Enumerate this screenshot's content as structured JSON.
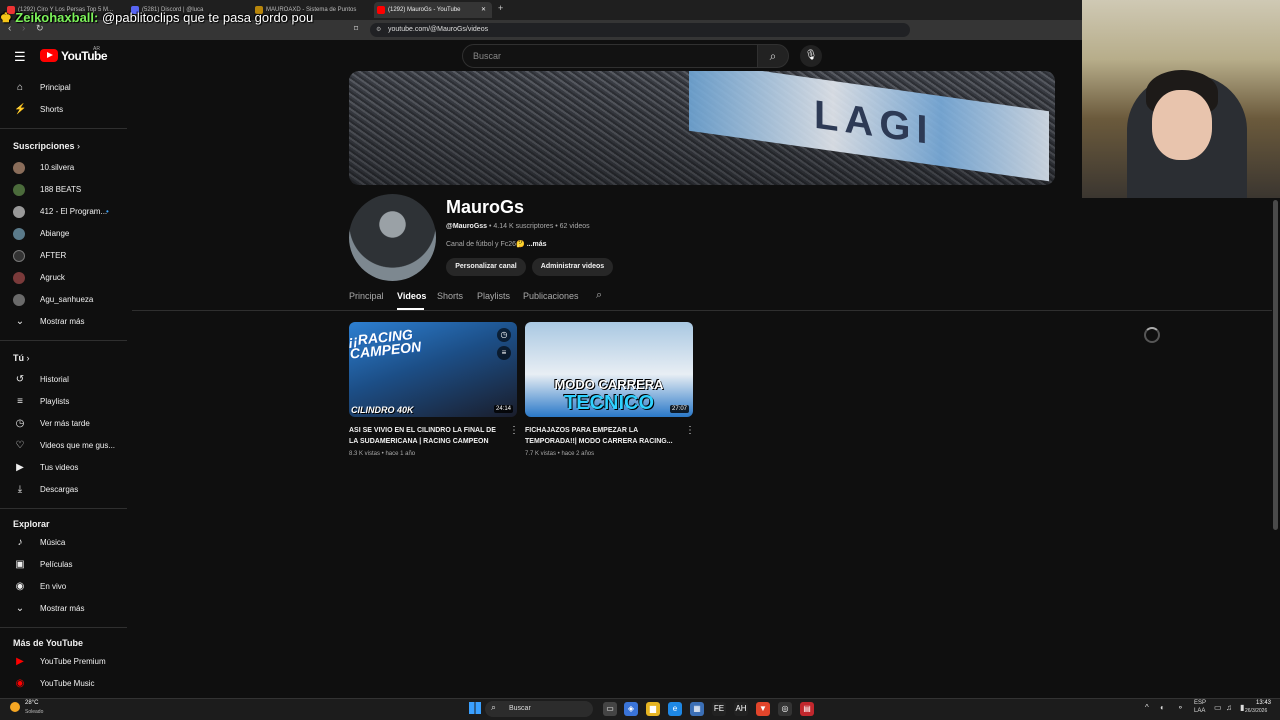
{
  "browser": {
    "tabs": [
      {
        "label": "(1292) Ciro Y Los Persas Top 5 M...",
        "color": "#e33"
      },
      {
        "label": "(5281) Discord | @luca",
        "color": "#5865f2"
      },
      {
        "label": "MAUROAXD - Sistema de Puntos",
        "color": "#b8860b"
      },
      {
        "label": "(1292) MauroGs - YouTube",
        "color": "#ff0000"
      }
    ],
    "url": "youtube.com/@MauroGs/videos"
  },
  "chat_overlay": {
    "user": "Zeikohaxball:",
    "message": " @pablitoclips que te pasa gordo pou"
  },
  "header": {
    "logo_text": "YouTube",
    "region": "AR",
    "search_placeholder": "Buscar"
  },
  "sidebar": {
    "main": [
      {
        "label": "Principal",
        "icon": "⌂"
      },
      {
        "label": "Shorts",
        "icon": "⚡"
      }
    ],
    "subs_heading": "Suscripciones",
    "subscriptions": [
      {
        "label": "10.silvera",
        "color": "#8a6d5a"
      },
      {
        "label": "188 BEATS",
        "color": "#4b6b3b"
      },
      {
        "label": "412 - El Program...",
        "color": "#999"
      },
      {
        "label": "Abiange",
        "color": "#5a7a8a"
      },
      {
        "label": "AFTER",
        "color": "#333"
      },
      {
        "label": "Agruck",
        "color": "#7a3a3a"
      },
      {
        "label": "Agu_sanhueza",
        "color": "#6a6a6a"
      }
    ],
    "subs_more": "Mostrar más",
    "you_heading": "Tú",
    "you": [
      {
        "label": "Historial",
        "icon": "↺"
      },
      {
        "label": "Playlists",
        "icon": "≡"
      },
      {
        "label": "Ver más tarde",
        "icon": "◷"
      },
      {
        "label": "Videos que me gus...",
        "icon": "👍"
      },
      {
        "label": "Tus videos",
        "icon": "▶"
      },
      {
        "label": "Descargas",
        "icon": "⤓"
      }
    ],
    "explore_heading": "Explorar",
    "explore": [
      {
        "label": "Música",
        "icon": "♪"
      },
      {
        "label": "Películas",
        "icon": "▣"
      },
      {
        "label": "En vivo",
        "icon": "◉"
      }
    ],
    "explore_more": "Mostrar más",
    "more_heading": "Más de YouTube",
    "more": [
      {
        "label": "YouTube Premium"
      },
      {
        "label": "YouTube Music"
      }
    ]
  },
  "channel": {
    "name": "MauroGs",
    "handle": "@MauroGss",
    "stats": " • 4.14 K suscriptores • 62 videos",
    "description": "Canal de fútbol y Fc26🤔 ",
    "desc_more": "...más",
    "customize_button": "Personalizar canal",
    "manage_button": "Administrar videos",
    "tabs": [
      "Principal",
      "Videos",
      "Shorts",
      "Playlists",
      "Publicaciones"
    ],
    "active_tab": "Videos",
    "banner_text": "LAGI"
  },
  "videos": [
    {
      "title": "ASI SE VIVIO EN EL CILINDRO LA FINAL DE LA SUDAMERICANA | RACING CAMPEON",
      "meta": "8.3 K vistas • hace 1 año",
      "duration": "24:14",
      "thumb_text_top": "¡¡RACING CAMPEON",
      "thumb_text_bottom": "CILINDRO 40K"
    },
    {
      "title": "FICHAJAZOS PARA EMPEZAR LA TEMPORADA!!| MODO CARRERA RACING...",
      "meta": "7.7 K vistas • hace 2 años",
      "duration": "27:07",
      "thumb_text_top": "MODO CARRERA",
      "thumb_text_bottom": "TECNICO"
    }
  ],
  "taskbar": {
    "weather_temp": "28°C",
    "weather_desc": "Soleado",
    "search_label": "Buscar",
    "lang": "ESP",
    "lang2": "LAA",
    "time": "13:43",
    "date": "26/3/2026"
  }
}
